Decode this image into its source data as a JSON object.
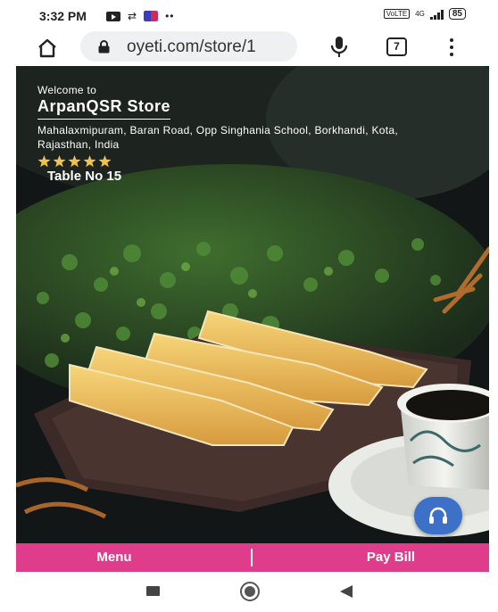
{
  "status_bar": {
    "time": "3:32 PM",
    "battery": "85",
    "network": "4G"
  },
  "browser": {
    "url": "oyeti.com/store/1",
    "tab_count": "7"
  },
  "store": {
    "welcome": "Welcome to",
    "name": "ArpanQSR Store",
    "address": "Mahalaxmipuram, Baran Road, Opp Singhania School, Borkhandi, Kota, Rajasthan, India",
    "rating": 5,
    "table": "Table No 15"
  },
  "bottom_nav": {
    "menu": "Menu",
    "pay_bill": "Pay Bill"
  },
  "colors": {
    "accent_pink": "#e03c8c",
    "support_blue": "#3c71c7",
    "star_gold": "#f2c14e"
  }
}
